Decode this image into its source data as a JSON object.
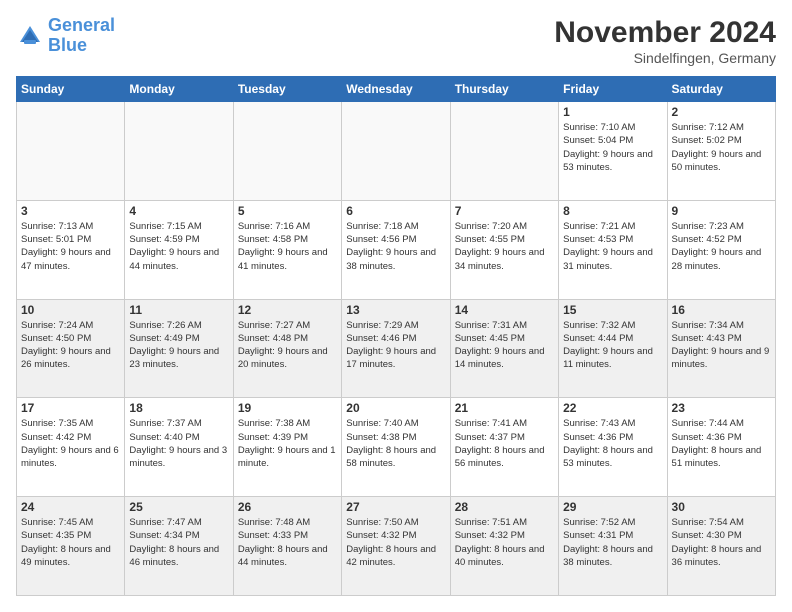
{
  "logo": {
    "line1": "General",
    "line2": "Blue"
  },
  "title": "November 2024",
  "location": "Sindelfingen, Germany",
  "days_of_week": [
    "Sunday",
    "Monday",
    "Tuesday",
    "Wednesday",
    "Thursday",
    "Friday",
    "Saturday"
  ],
  "weeks": [
    [
      {
        "day": "",
        "info": ""
      },
      {
        "day": "",
        "info": ""
      },
      {
        "day": "",
        "info": ""
      },
      {
        "day": "",
        "info": ""
      },
      {
        "day": "",
        "info": ""
      },
      {
        "day": "1",
        "info": "Sunrise: 7:10 AM\nSunset: 5:04 PM\nDaylight: 9 hours and 53 minutes."
      },
      {
        "day": "2",
        "info": "Sunrise: 7:12 AM\nSunset: 5:02 PM\nDaylight: 9 hours and 50 minutes."
      }
    ],
    [
      {
        "day": "3",
        "info": "Sunrise: 7:13 AM\nSunset: 5:01 PM\nDaylight: 9 hours and 47 minutes."
      },
      {
        "day": "4",
        "info": "Sunrise: 7:15 AM\nSunset: 4:59 PM\nDaylight: 9 hours and 44 minutes."
      },
      {
        "day": "5",
        "info": "Sunrise: 7:16 AM\nSunset: 4:58 PM\nDaylight: 9 hours and 41 minutes."
      },
      {
        "day": "6",
        "info": "Sunrise: 7:18 AM\nSunset: 4:56 PM\nDaylight: 9 hours and 38 minutes."
      },
      {
        "day": "7",
        "info": "Sunrise: 7:20 AM\nSunset: 4:55 PM\nDaylight: 9 hours and 34 minutes."
      },
      {
        "day": "8",
        "info": "Sunrise: 7:21 AM\nSunset: 4:53 PM\nDaylight: 9 hours and 31 minutes."
      },
      {
        "day": "9",
        "info": "Sunrise: 7:23 AM\nSunset: 4:52 PM\nDaylight: 9 hours and 28 minutes."
      }
    ],
    [
      {
        "day": "10",
        "info": "Sunrise: 7:24 AM\nSunset: 4:50 PM\nDaylight: 9 hours and 26 minutes."
      },
      {
        "day": "11",
        "info": "Sunrise: 7:26 AM\nSunset: 4:49 PM\nDaylight: 9 hours and 23 minutes."
      },
      {
        "day": "12",
        "info": "Sunrise: 7:27 AM\nSunset: 4:48 PM\nDaylight: 9 hours and 20 minutes."
      },
      {
        "day": "13",
        "info": "Sunrise: 7:29 AM\nSunset: 4:46 PM\nDaylight: 9 hours and 17 minutes."
      },
      {
        "day": "14",
        "info": "Sunrise: 7:31 AM\nSunset: 4:45 PM\nDaylight: 9 hours and 14 minutes."
      },
      {
        "day": "15",
        "info": "Sunrise: 7:32 AM\nSunset: 4:44 PM\nDaylight: 9 hours and 11 minutes."
      },
      {
        "day": "16",
        "info": "Sunrise: 7:34 AM\nSunset: 4:43 PM\nDaylight: 9 hours and 9 minutes."
      }
    ],
    [
      {
        "day": "17",
        "info": "Sunrise: 7:35 AM\nSunset: 4:42 PM\nDaylight: 9 hours and 6 minutes."
      },
      {
        "day": "18",
        "info": "Sunrise: 7:37 AM\nSunset: 4:40 PM\nDaylight: 9 hours and 3 minutes."
      },
      {
        "day": "19",
        "info": "Sunrise: 7:38 AM\nSunset: 4:39 PM\nDaylight: 9 hours and 1 minute."
      },
      {
        "day": "20",
        "info": "Sunrise: 7:40 AM\nSunset: 4:38 PM\nDaylight: 8 hours and 58 minutes."
      },
      {
        "day": "21",
        "info": "Sunrise: 7:41 AM\nSunset: 4:37 PM\nDaylight: 8 hours and 56 minutes."
      },
      {
        "day": "22",
        "info": "Sunrise: 7:43 AM\nSunset: 4:36 PM\nDaylight: 8 hours and 53 minutes."
      },
      {
        "day": "23",
        "info": "Sunrise: 7:44 AM\nSunset: 4:36 PM\nDaylight: 8 hours and 51 minutes."
      }
    ],
    [
      {
        "day": "24",
        "info": "Sunrise: 7:45 AM\nSunset: 4:35 PM\nDaylight: 8 hours and 49 minutes."
      },
      {
        "day": "25",
        "info": "Sunrise: 7:47 AM\nSunset: 4:34 PM\nDaylight: 8 hours and 46 minutes."
      },
      {
        "day": "26",
        "info": "Sunrise: 7:48 AM\nSunset: 4:33 PM\nDaylight: 8 hours and 44 minutes."
      },
      {
        "day": "27",
        "info": "Sunrise: 7:50 AM\nSunset: 4:32 PM\nDaylight: 8 hours and 42 minutes."
      },
      {
        "day": "28",
        "info": "Sunrise: 7:51 AM\nSunset: 4:32 PM\nDaylight: 8 hours and 40 minutes."
      },
      {
        "day": "29",
        "info": "Sunrise: 7:52 AM\nSunset: 4:31 PM\nDaylight: 8 hours and 38 minutes."
      },
      {
        "day": "30",
        "info": "Sunrise: 7:54 AM\nSunset: 4:30 PM\nDaylight: 8 hours and 36 minutes."
      }
    ]
  ]
}
